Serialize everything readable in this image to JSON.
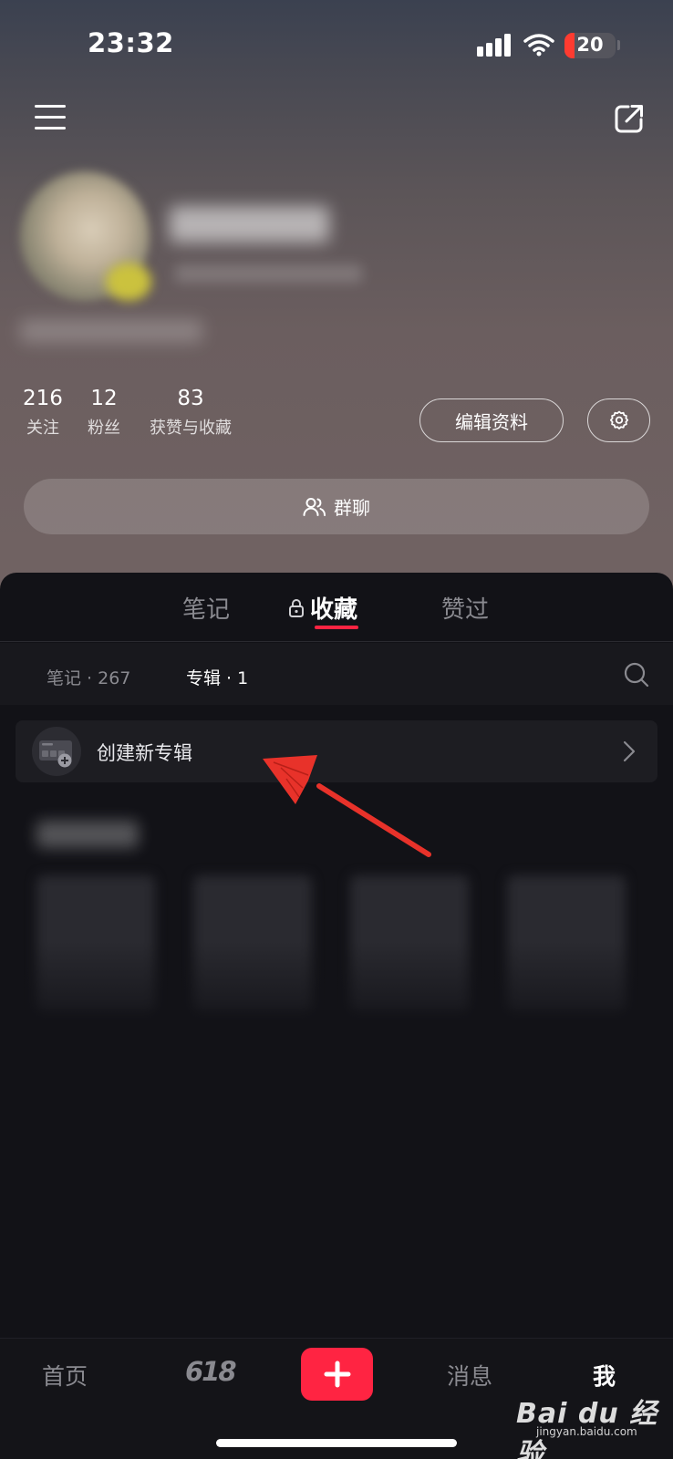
{
  "status_bar": {
    "time": "23:32",
    "battery": "20"
  },
  "profile": {
    "stats": [
      {
        "value": "216",
        "label": "关注"
      },
      {
        "value": "12",
        "label": "粉丝"
      },
      {
        "value": "83",
        "label": "获赞与收藏"
      }
    ],
    "edit_button": "编辑资料",
    "group_chat": "群聊"
  },
  "tabs": {
    "notes": "笔记",
    "favorites": "收藏",
    "liked": "赞过",
    "active": "收藏"
  },
  "subtabs": {
    "notes": "笔记 · 267",
    "albums": "专辑 · 1",
    "active": "专辑 · 1"
  },
  "create_album": {
    "label": "创建新专辑"
  },
  "bottom_nav": {
    "home": "首页",
    "promo": "618",
    "messages": "消息",
    "me": "我",
    "active": "我"
  },
  "watermark": {
    "brand": "Bai du 经验",
    "url": "jingyan.baidu.com"
  },
  "colors": {
    "accent": "#ff2442",
    "annotation_arrow": "#e8322a",
    "panel_bg": "#121217"
  }
}
